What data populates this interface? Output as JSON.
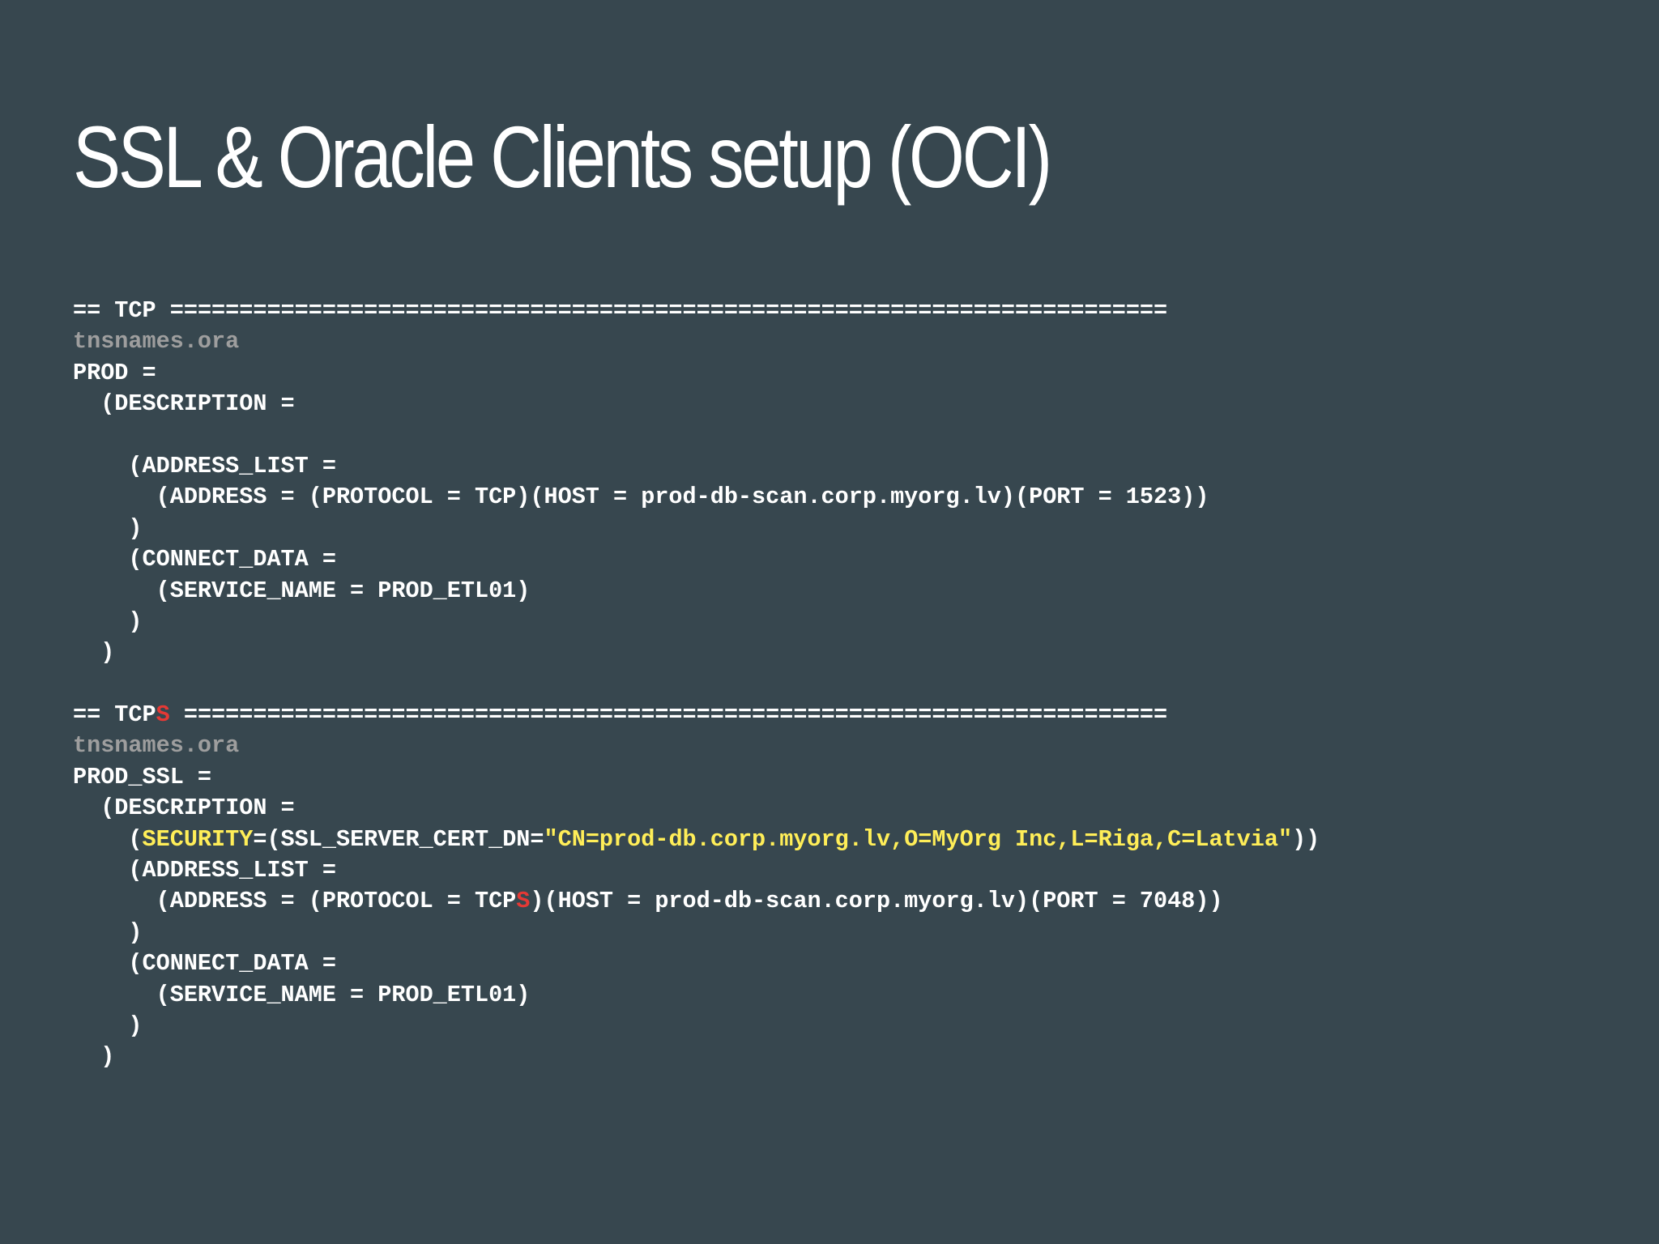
{
  "slide": {
    "title": "SSL & Oracle Clients setup (OCI)"
  },
  "tcp_block": {
    "header_prefix": "== TCP ",
    "header_rule": "========================================================================",
    "file_label": "tnsnames.ora",
    "alias_line": "PROD =",
    "description_line": "  (DESCRIPTION =",
    "blank_line": "",
    "address_list_line": "    (ADDRESS_LIST =",
    "address_line": "      (ADDRESS = (PROTOCOL = TCP)(HOST = prod-db-scan.corp.myorg.lv)(PORT = 1523))",
    "close_address_list": "    )",
    "connect_data_line": "    (CONNECT_DATA =",
    "service_name_line": "      (SERVICE_NAME = PROD_ETL01)",
    "close_connect_data": "    )",
    "close_description": "  )"
  },
  "tcps_block": {
    "header_prefix": "== TCP",
    "header_accent": "S",
    "header_rule": " =======================================================================",
    "file_label": "tnsnames.ora",
    "alias_line": "PROD_SSL =",
    "description_line": "  (DESCRIPTION =",
    "security_open": "    (",
    "security_keyword": "SECURITY",
    "security_middle": "=(SSL_SERVER_CERT_DN=",
    "security_value": "\"CN=prod-db.corp.myorg.lv,O=MyOrg Inc,L=Riga,C=Latvia\"",
    "security_close": "))",
    "address_list_line": "    (ADDRESS_LIST =",
    "address_prefix": "      (ADDRESS = (PROTOCOL = TCP",
    "address_accent": "S",
    "address_suffix": ")(HOST = prod-db-scan.corp.myorg.lv)(PORT = 7048))",
    "close_address_list": "    )",
    "connect_data_line": "    (CONNECT_DATA =",
    "service_name_line": "      (SERVICE_NAME = PROD_ETL01)",
    "close_connect_data": "    )",
    "close_description": "  )"
  },
  "colors": {
    "background": "#37474f",
    "text": "#ffffff",
    "comment": "#9e9e9e",
    "accent_red": "#e53935",
    "highlight_yellow": "#ffee58"
  }
}
